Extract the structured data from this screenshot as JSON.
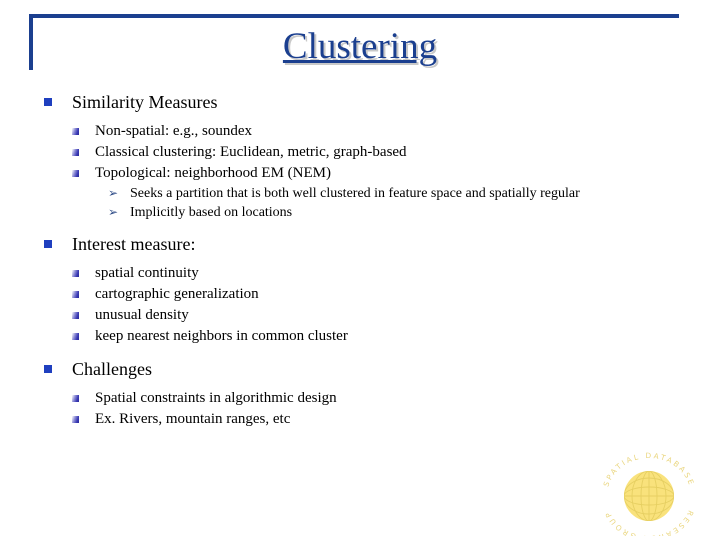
{
  "slide": {
    "title": "Clustering",
    "frame_color": "#1b3f8f",
    "title_color": "#1b3f8f",
    "bullet_color_l1": "#1f3fbf",
    "bullet_color_l3": "#2d4b86",
    "background": "#ffffff"
  },
  "outline": [
    {
      "level": 1,
      "bullet": "square-bullet",
      "text": "Similarity Measures"
    },
    {
      "level": 2,
      "bullet": "small-square-bullet",
      "text": "Non-spatial: e.g., soundex"
    },
    {
      "level": 2,
      "bullet": "small-square-bullet",
      "text": "Classical clustering: Euclidean, metric, graph-based"
    },
    {
      "level": 2,
      "bullet": "small-square-bullet",
      "text": "Topological: neighborhood EM (NEM)"
    },
    {
      "level": 3,
      "bullet": "arrow-bullet",
      "glyph": "➢",
      "text": "Seeks a partition that is both well clustered in feature space and spatially regular"
    },
    {
      "level": 3,
      "bullet": "arrow-bullet",
      "glyph": "➢",
      "text": "Implicitly based on locations"
    },
    {
      "level": 1,
      "bullet": "square-bullet",
      "text": "Interest measure:"
    },
    {
      "level": 2,
      "bullet": "small-square-bullet",
      "text": "spatial continuity"
    },
    {
      "level": 2,
      "bullet": "small-square-bullet",
      "text": "cartographic generalization"
    },
    {
      "level": 2,
      "bullet": "small-square-bullet",
      "text": "unusual density"
    },
    {
      "level": 2,
      "bullet": "small-square-bullet",
      "text": "keep nearest neighbors in common cluster"
    },
    {
      "level": 1,
      "bullet": "square-bullet",
      "text": "Challenges"
    },
    {
      "level": 2,
      "bullet": "small-square-bullet",
      "text": "Spatial constraints in algorithmic design"
    },
    {
      "level": 2,
      "bullet": "small-square-bullet",
      "text": "Ex. Rivers, mountain ranges, etc"
    }
  ],
  "logo": {
    "name": "spatial-database-research-group-logo",
    "ring_text_top": "SPATIAL DATABASE",
    "ring_text_bottom": "RESEARCH GROUP",
    "globe_color": "#f7e27a",
    "ring_text_color": "#e8d37a"
  }
}
